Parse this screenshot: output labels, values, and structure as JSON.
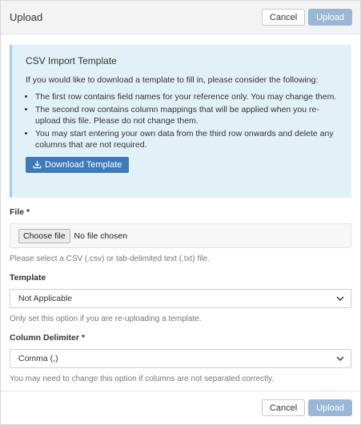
{
  "header": {
    "title": "Upload",
    "cancel_label": "Cancel",
    "upload_label": "Upload"
  },
  "info": {
    "title": "CSV Import Template",
    "intro": "If you would like to download a template to fill in, please consider the following:",
    "bullets": [
      "The first row contains field names for your reference only. You may change them.",
      "The second row contains column mappings that will be applied when you re-upload this file. Please do not change them.",
      "You may start entering your own data from the third row onwards and delete any columns that are not required."
    ],
    "download_label": "Download Template",
    "download_icon": "download-icon"
  },
  "file": {
    "label": "File *",
    "button_label": "Choose file",
    "status": "No file chosen",
    "help": "Please select a CSV (.csv) or tab-delimited text (.txt) file."
  },
  "template": {
    "label": "Template",
    "selected": "Not Applicable",
    "help": "Only set this option if you are re-uploading a template."
  },
  "delimiter": {
    "label": "Column Delimiter *",
    "selected": "Comma (,)",
    "help": "You may need to change this option if columns are not separated correctly."
  },
  "footer": {
    "cancel_label": "Cancel",
    "upload_label": "Upload"
  },
  "colors": {
    "info_bg": "#e2f0f7",
    "primary": "#3f7ab8",
    "primary_disabled": "#9ab7d6"
  }
}
